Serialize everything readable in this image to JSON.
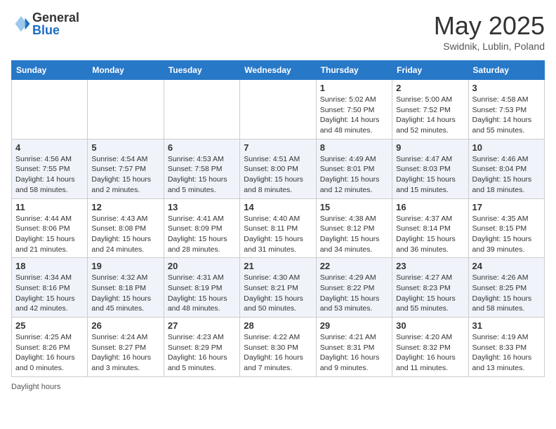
{
  "header": {
    "logo_general": "General",
    "logo_blue": "Blue",
    "month_title": "May 2025",
    "location": "Swidnik, Lublin, Poland"
  },
  "weekdays": [
    "Sunday",
    "Monday",
    "Tuesday",
    "Wednesday",
    "Thursday",
    "Friday",
    "Saturday"
  ],
  "weeks": [
    [
      {
        "day": "",
        "info": ""
      },
      {
        "day": "",
        "info": ""
      },
      {
        "day": "",
        "info": ""
      },
      {
        "day": "",
        "info": ""
      },
      {
        "day": "1",
        "info": "Sunrise: 5:02 AM\nSunset: 7:50 PM\nDaylight: 14 hours and 48 minutes."
      },
      {
        "day": "2",
        "info": "Sunrise: 5:00 AM\nSunset: 7:52 PM\nDaylight: 14 hours and 52 minutes."
      },
      {
        "day": "3",
        "info": "Sunrise: 4:58 AM\nSunset: 7:53 PM\nDaylight: 14 hours and 55 minutes."
      }
    ],
    [
      {
        "day": "4",
        "info": "Sunrise: 4:56 AM\nSunset: 7:55 PM\nDaylight: 14 hours and 58 minutes."
      },
      {
        "day": "5",
        "info": "Sunrise: 4:54 AM\nSunset: 7:57 PM\nDaylight: 15 hours and 2 minutes."
      },
      {
        "day": "6",
        "info": "Sunrise: 4:53 AM\nSunset: 7:58 PM\nDaylight: 15 hours and 5 minutes."
      },
      {
        "day": "7",
        "info": "Sunrise: 4:51 AM\nSunset: 8:00 PM\nDaylight: 15 hours and 8 minutes."
      },
      {
        "day": "8",
        "info": "Sunrise: 4:49 AM\nSunset: 8:01 PM\nDaylight: 15 hours and 12 minutes."
      },
      {
        "day": "9",
        "info": "Sunrise: 4:47 AM\nSunset: 8:03 PM\nDaylight: 15 hours and 15 minutes."
      },
      {
        "day": "10",
        "info": "Sunrise: 4:46 AM\nSunset: 8:04 PM\nDaylight: 15 hours and 18 minutes."
      }
    ],
    [
      {
        "day": "11",
        "info": "Sunrise: 4:44 AM\nSunset: 8:06 PM\nDaylight: 15 hours and 21 minutes."
      },
      {
        "day": "12",
        "info": "Sunrise: 4:43 AM\nSunset: 8:08 PM\nDaylight: 15 hours and 24 minutes."
      },
      {
        "day": "13",
        "info": "Sunrise: 4:41 AM\nSunset: 8:09 PM\nDaylight: 15 hours and 28 minutes."
      },
      {
        "day": "14",
        "info": "Sunrise: 4:40 AM\nSunset: 8:11 PM\nDaylight: 15 hours and 31 minutes."
      },
      {
        "day": "15",
        "info": "Sunrise: 4:38 AM\nSunset: 8:12 PM\nDaylight: 15 hours and 34 minutes."
      },
      {
        "day": "16",
        "info": "Sunrise: 4:37 AM\nSunset: 8:14 PM\nDaylight: 15 hours and 36 minutes."
      },
      {
        "day": "17",
        "info": "Sunrise: 4:35 AM\nSunset: 8:15 PM\nDaylight: 15 hours and 39 minutes."
      }
    ],
    [
      {
        "day": "18",
        "info": "Sunrise: 4:34 AM\nSunset: 8:16 PM\nDaylight: 15 hours and 42 minutes."
      },
      {
        "day": "19",
        "info": "Sunrise: 4:32 AM\nSunset: 8:18 PM\nDaylight: 15 hours and 45 minutes."
      },
      {
        "day": "20",
        "info": "Sunrise: 4:31 AM\nSunset: 8:19 PM\nDaylight: 15 hours and 48 minutes."
      },
      {
        "day": "21",
        "info": "Sunrise: 4:30 AM\nSunset: 8:21 PM\nDaylight: 15 hours and 50 minutes."
      },
      {
        "day": "22",
        "info": "Sunrise: 4:29 AM\nSunset: 8:22 PM\nDaylight: 15 hours and 53 minutes."
      },
      {
        "day": "23",
        "info": "Sunrise: 4:27 AM\nSunset: 8:23 PM\nDaylight: 15 hours and 55 minutes."
      },
      {
        "day": "24",
        "info": "Sunrise: 4:26 AM\nSunset: 8:25 PM\nDaylight: 15 hours and 58 minutes."
      }
    ],
    [
      {
        "day": "25",
        "info": "Sunrise: 4:25 AM\nSunset: 8:26 PM\nDaylight: 16 hours and 0 minutes."
      },
      {
        "day": "26",
        "info": "Sunrise: 4:24 AM\nSunset: 8:27 PM\nDaylight: 16 hours and 3 minutes."
      },
      {
        "day": "27",
        "info": "Sunrise: 4:23 AM\nSunset: 8:29 PM\nDaylight: 16 hours and 5 minutes."
      },
      {
        "day": "28",
        "info": "Sunrise: 4:22 AM\nSunset: 8:30 PM\nDaylight: 16 hours and 7 minutes."
      },
      {
        "day": "29",
        "info": "Sunrise: 4:21 AM\nSunset: 8:31 PM\nDaylight: 16 hours and 9 minutes."
      },
      {
        "day": "30",
        "info": "Sunrise: 4:20 AM\nSunset: 8:32 PM\nDaylight: 16 hours and 11 minutes."
      },
      {
        "day": "31",
        "info": "Sunrise: 4:19 AM\nSunset: 8:33 PM\nDaylight: 16 hours and 13 minutes."
      }
    ]
  ],
  "footer": {
    "daylight_label": "Daylight hours"
  }
}
